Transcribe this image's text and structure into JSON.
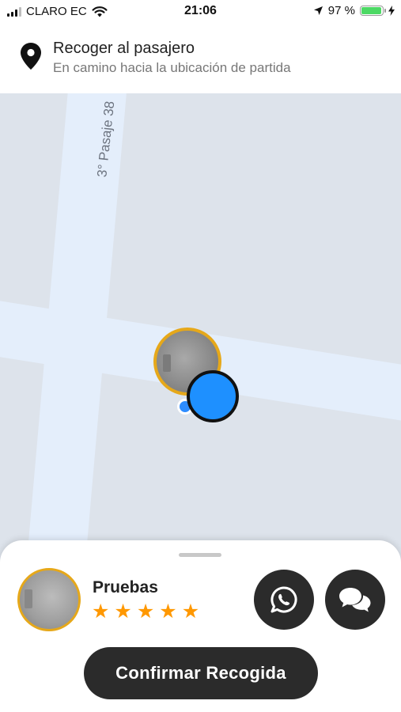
{
  "status_bar": {
    "carrier": "CLARO EC",
    "time": "21:06",
    "battery": "97 %",
    "battery_level": 0.97
  },
  "banner": {
    "title": "Recoger al pasajero",
    "subtitle": "En camino hacia la ubicación de partida"
  },
  "map": {
    "street_label": "3° Pasaje 38"
  },
  "passenger": {
    "name": "Pruebas",
    "rating": 5
  },
  "actions": {
    "confirm_label": "Confirmar Recogida"
  },
  "icons": {
    "signal": "signal-bars-icon",
    "wifi": "wifi-icon",
    "location_arrow": "location-arrow-icon",
    "battery": "battery-icon",
    "charging": "charging-bolt-icon",
    "pin": "map-pin-icon",
    "whatsapp": "whatsapp-icon",
    "chat": "chat-bubbles-icon",
    "star": "star-icon"
  },
  "colors": {
    "accent_border": "#e6a81a",
    "driver_marker": "#1e90ff",
    "button_bg": "#2b2b2b",
    "star": "#ff9800",
    "battery_fill": "#4cd964"
  }
}
